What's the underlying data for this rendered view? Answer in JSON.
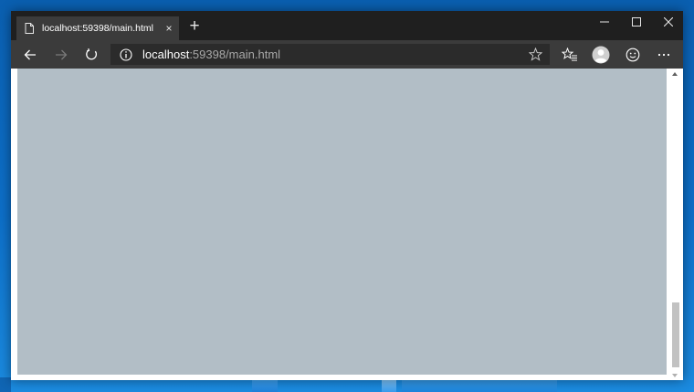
{
  "tab": {
    "title": "localhost:59398/main.html",
    "close_icon": "×"
  },
  "new_tab_icon": "+",
  "address_bar": {
    "host": "localhost",
    "rest": ":59398/main.html"
  },
  "colors": {
    "titlebar": "#1f1f1f",
    "toolbar": "#3b3b3b",
    "address_field": "#2b2b2b",
    "page_background": "#b2bec6",
    "desktop": "#0d6fc8"
  },
  "icons": [
    "page-icon",
    "close-icon",
    "new-tab-icon",
    "minimize-icon",
    "maximize-icon",
    "close-window-icon",
    "back-icon",
    "forward-icon",
    "refresh-icon",
    "info-icon",
    "favorite-star-icon",
    "favorites-list-icon",
    "profile-avatar-icon",
    "feedback-smiley-icon",
    "more-icon"
  ]
}
